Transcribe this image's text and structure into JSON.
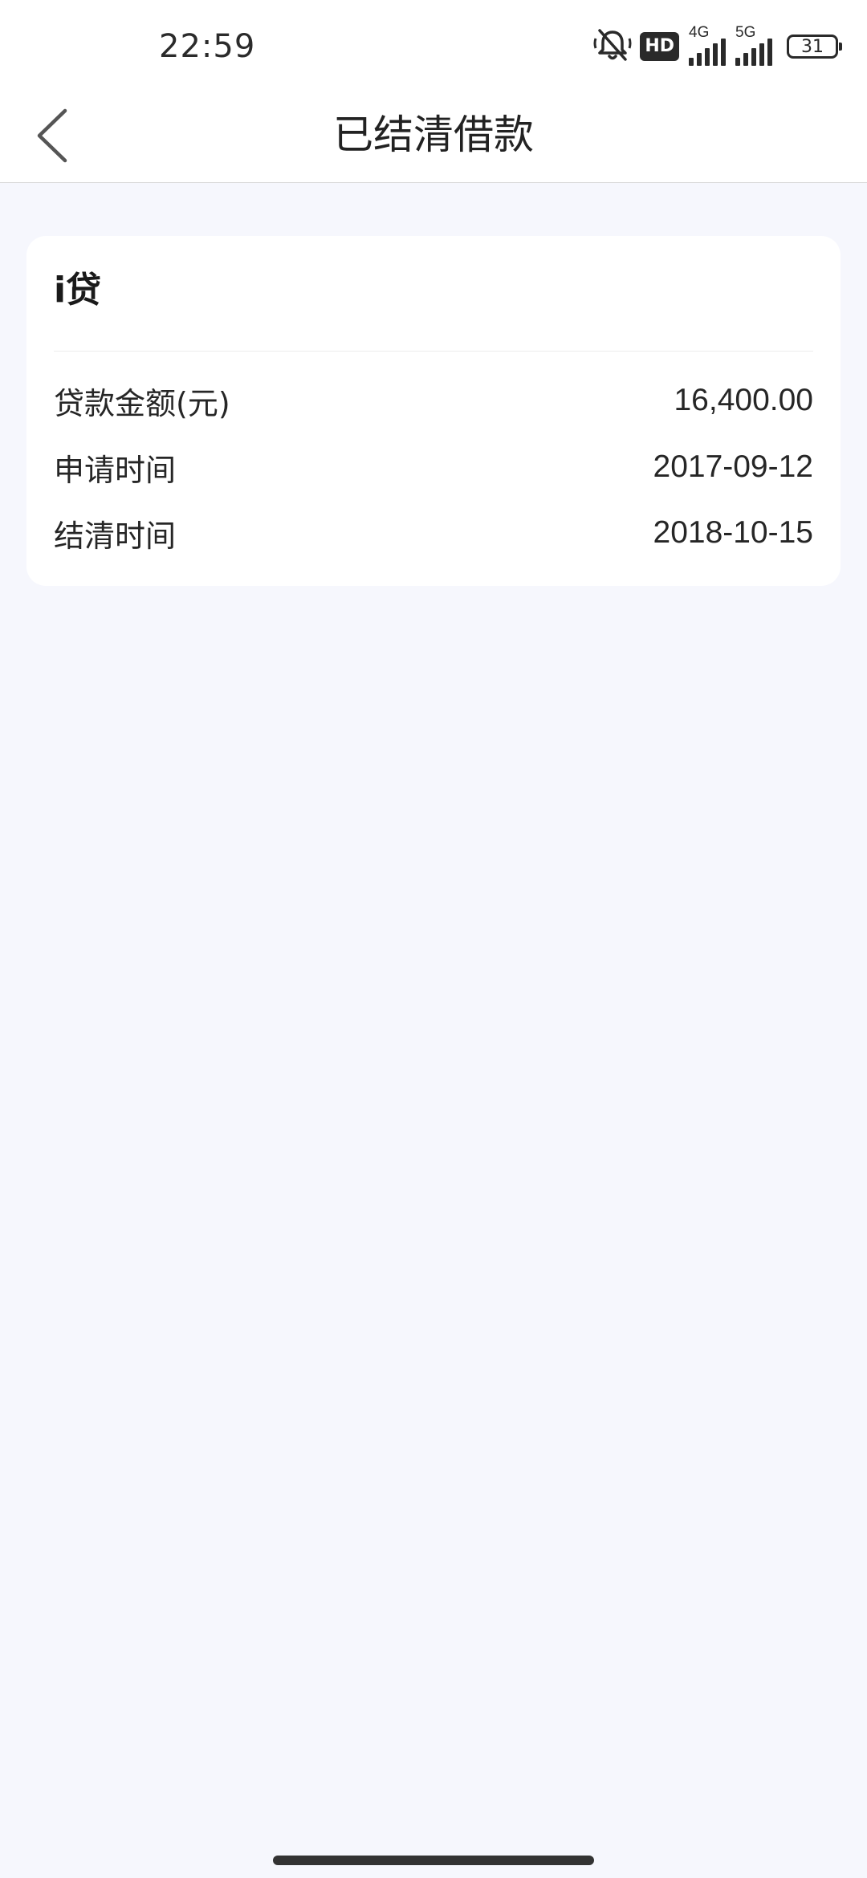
{
  "status_bar": {
    "time": "22:59",
    "hd_label": "HD",
    "net1_label": "4G",
    "net2_label": "5G",
    "battery": "31",
    "icons": [
      "bell-off-icon",
      "hd-voice-icon",
      "signal-4g-icon",
      "signal-5g-icon",
      "battery-icon"
    ]
  },
  "nav": {
    "title": "已结清借款",
    "back_icon": "chevron-left-icon"
  },
  "loan": {
    "name": "i贷",
    "rows": [
      {
        "label": "贷款金额(元)",
        "value": "16,400.00"
      },
      {
        "label": "申请时间",
        "value": "2017-09-12"
      },
      {
        "label": "结清时间",
        "value": "2018-10-15"
      }
    ]
  },
  "colors": {
    "page_background": "#f6f7fd",
    "card_background": "#ffffff",
    "text_primary": "#262626"
  }
}
